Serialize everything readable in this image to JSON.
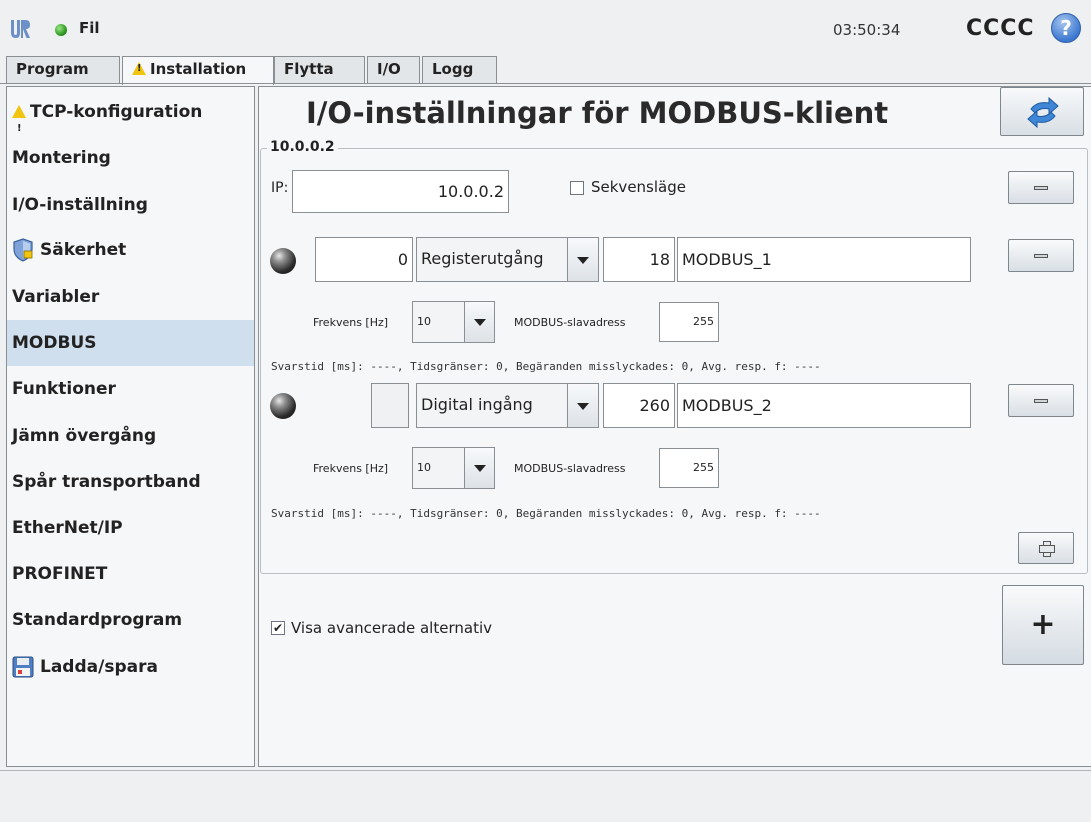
{
  "topbar": {
    "file_menu": "Fil",
    "clock": "03:50:34",
    "robot_name": "CCCC",
    "help": "?"
  },
  "tabs": [
    {
      "label": "Program"
    },
    {
      "label": "Installation",
      "warning": true
    },
    {
      "label": "Flytta"
    },
    {
      "label": "I/O"
    },
    {
      "label": "Logg"
    }
  ],
  "sidebar": {
    "items": [
      {
        "label": "TCP-konfiguration",
        "icon": "warning-icon"
      },
      {
        "label": "Montering"
      },
      {
        "label": "I/O-inställning"
      },
      {
        "label": "Säkerhet",
        "icon": "shield-icon"
      },
      {
        "label": "Variabler"
      },
      {
        "label": "MODBUS",
        "selected": true
      },
      {
        "label": "Funktioner"
      },
      {
        "label": "Jämn övergång"
      },
      {
        "label": "Spår transportband"
      },
      {
        "label": "EtherNet/IP"
      },
      {
        "label": "PROFINET"
      },
      {
        "label": "Standardprogram"
      },
      {
        "label": "Ladda/spara",
        "icon": "floppy-disk-icon"
      }
    ]
  },
  "main": {
    "title": "I/O-inställningar för MODBUS-klient",
    "group_title": "10.0.0.2",
    "ip_label": "IP:",
    "ip_value": "10.0.0.2",
    "sequential_label": "Sekvensläge",
    "sequential_checked": false,
    "signals": [
      {
        "address": "0",
        "type": "Registerutgång",
        "register": "18",
        "name": "MODBUS_1",
        "freq_label": "Frekvens [Hz]",
        "freq_value": "10",
        "slave_label": "MODBUS-slavadress",
        "slave_value": "255",
        "status": "Svarstid [ms]: ----, Tidsgränser: 0, Begäranden misslyckades: 0, Avg. resp. f: ----"
      },
      {
        "address": "",
        "type": "Digital ingång",
        "register": "260",
        "name": "MODBUS_2",
        "freq_label": "Frekvens [Hz]",
        "freq_value": "10",
        "slave_label": "MODBUS-slavadress",
        "slave_value": "255",
        "status": "Svarstid [ms]: ----, Tidsgränser: 0, Begäranden misslyckades: 0, Avg. resp. f: ----"
      }
    ],
    "advanced_label": "Visa avancerade alternativ",
    "advanced_checked": true,
    "add_unit_label": "+"
  },
  "colors": {
    "selected_bg": "#cfdfee",
    "warning": "#f1c40f",
    "status_ok": "#2f9a20",
    "help_blue": "#3d78d0"
  }
}
